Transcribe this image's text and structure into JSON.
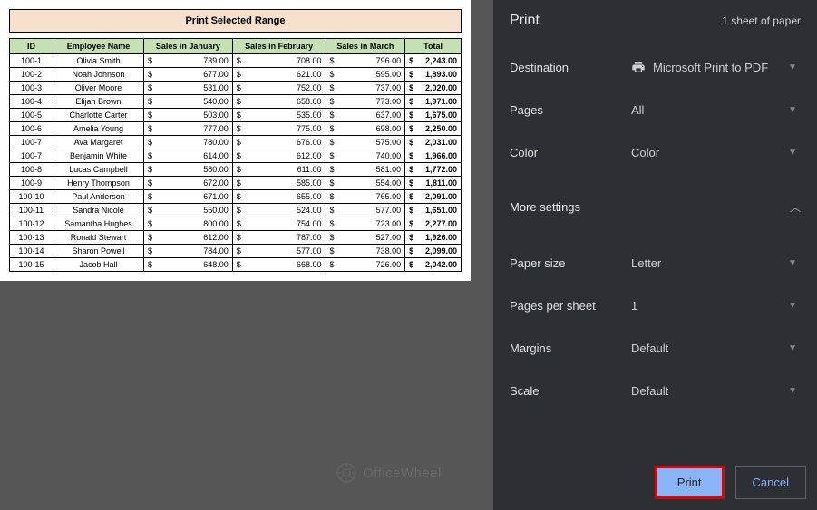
{
  "sheet": {
    "title": "Print Selected Range",
    "headers": [
      "ID",
      "Employee Name",
      "Sales in January",
      "Sales in February",
      "Sales in March",
      "Total"
    ],
    "rows": [
      {
        "id": "100-1",
        "name": "Olivia Smith",
        "jan": "739.00",
        "feb": "708.00",
        "mar": "796.00",
        "tot": "2,243.00"
      },
      {
        "id": "100-2",
        "name": "Noah Johnson",
        "jan": "677.00",
        "feb": "621.00",
        "mar": "595.00",
        "tot": "1,893.00"
      },
      {
        "id": "100-3",
        "name": "Oliver Moore",
        "jan": "531.00",
        "feb": "752.00",
        "mar": "737.00",
        "tot": "2,020.00"
      },
      {
        "id": "100-4",
        "name": "Elijah Brown",
        "jan": "540.00",
        "feb": "658.00",
        "mar": "773.00",
        "tot": "1,971.00"
      },
      {
        "id": "100-5",
        "name": "Charlotte Carter",
        "jan": "503.00",
        "feb": "535.00",
        "mar": "637.00",
        "tot": "1,675.00"
      },
      {
        "id": "100-6",
        "name": "Amelia Young",
        "jan": "777.00",
        "feb": "775.00",
        "mar": "698.00",
        "tot": "2,250.00"
      },
      {
        "id": "100-7",
        "name": "Ava Margaret",
        "jan": "780.00",
        "feb": "676.00",
        "mar": "575.00",
        "tot": "2,031.00"
      },
      {
        "id": "100-7",
        "name": "Benjamin White",
        "jan": "614.00",
        "feb": "612.00",
        "mar": "740.00",
        "tot": "1,966.00"
      },
      {
        "id": "100-8",
        "name": "Lucas Campbell",
        "jan": "580.00",
        "feb": "611.00",
        "mar": "581.00",
        "tot": "1,772.00"
      },
      {
        "id": "100-9",
        "name": "Henry Thompson",
        "jan": "672.00",
        "feb": "585.00",
        "mar": "554.00",
        "tot": "1,811.00"
      },
      {
        "id": "100-10",
        "name": "Paul Anderson",
        "jan": "671.00",
        "feb": "655.00",
        "mar": "765.00",
        "tot": "2,091.00"
      },
      {
        "id": "100-11",
        "name": "Sandra Nicole",
        "jan": "550.00",
        "feb": "524.00",
        "mar": "577.00",
        "tot": "1,651.00"
      },
      {
        "id": "100-12",
        "name": "Samantha Hughes",
        "jan": "800.00",
        "feb": "754.00",
        "mar": "723.00",
        "tot": "2,277.00"
      },
      {
        "id": "100-13",
        "name": "Ronald Stewart",
        "jan": "612.00",
        "feb": "787.00",
        "mar": "527.00",
        "tot": "1,926.00"
      },
      {
        "id": "100-14",
        "name": "Sharon Powell",
        "jan": "784.00",
        "feb": "577.00",
        "mar": "738.00",
        "tot": "2,099.00"
      },
      {
        "id": "100-15",
        "name": "Jacob Hall",
        "jan": "648.00",
        "feb": "668.00",
        "mar": "726.00",
        "tot": "2,042.00"
      }
    ]
  },
  "watermark": "OfficeWheel",
  "panel": {
    "title": "Print",
    "sheetCount": "1 sheet of paper",
    "destination": {
      "label": "Destination",
      "value": "Microsoft Print to PDF"
    },
    "pages": {
      "label": "Pages",
      "value": "All"
    },
    "color": {
      "label": "Color",
      "value": "Color"
    },
    "moreSettings": "More settings",
    "paperSize": {
      "label": "Paper size",
      "value": "Letter"
    },
    "pagesPerSheet": {
      "label": "Pages per sheet",
      "value": "1"
    },
    "margins": {
      "label": "Margins",
      "value": "Default"
    },
    "scale": {
      "label": "Scale",
      "value": "Default"
    },
    "printBtn": "Print",
    "cancelBtn": "Cancel"
  }
}
